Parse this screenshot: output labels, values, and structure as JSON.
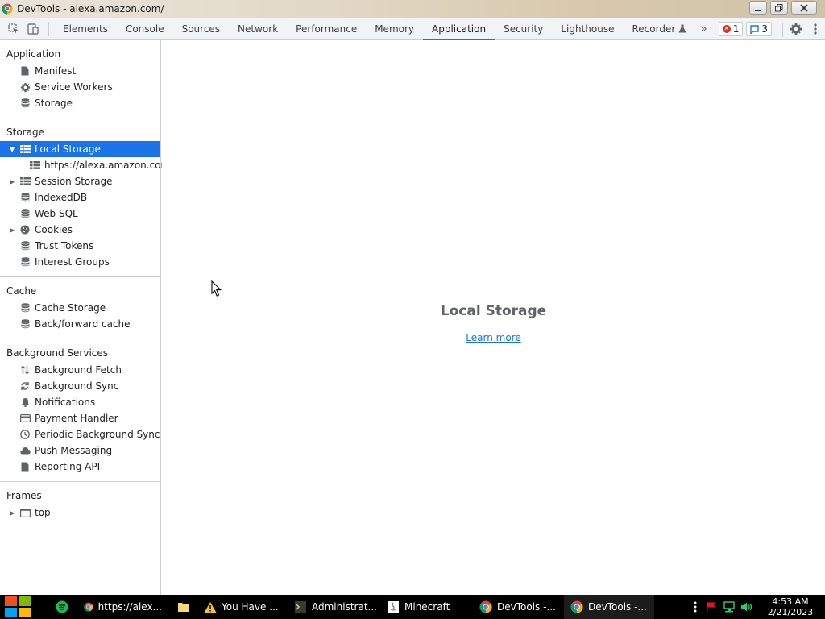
{
  "window": {
    "title": "DevTools - alexa.amazon.com/"
  },
  "toolbar": {
    "tabs": [
      {
        "label": "Elements"
      },
      {
        "label": "Console"
      },
      {
        "label": "Sources"
      },
      {
        "label": "Network"
      },
      {
        "label": "Performance"
      },
      {
        "label": "Memory"
      },
      {
        "label": "Application"
      },
      {
        "label": "Security"
      },
      {
        "label": "Lighthouse"
      },
      {
        "label": "Recorder"
      }
    ],
    "active_tab": "Application",
    "more": "»",
    "error_count": "1",
    "message_count": "3"
  },
  "sidebar": {
    "application": {
      "title": "Application",
      "items": [
        {
          "label": "Manifest",
          "icon": "file-icon"
        },
        {
          "label": "Service Workers",
          "icon": "gear-icon"
        },
        {
          "label": "Storage",
          "icon": "database-icon"
        }
      ]
    },
    "storage": {
      "title": "Storage",
      "items": [
        {
          "label": "Local Storage",
          "icon": "grid-icon"
        },
        {
          "label": "https://alexa.amazon.com",
          "icon": "grid-icon"
        },
        {
          "label": "Session Storage",
          "icon": "grid-icon"
        },
        {
          "label": "IndexedDB",
          "icon": "database-icon"
        },
        {
          "label": "Web SQL",
          "icon": "database-icon"
        },
        {
          "label": "Cookies",
          "icon": "cookie-icon"
        },
        {
          "label": "Trust Tokens",
          "icon": "database-icon"
        },
        {
          "label": "Interest Groups",
          "icon": "database-icon"
        }
      ]
    },
    "cache": {
      "title": "Cache",
      "items": [
        {
          "label": "Cache Storage",
          "icon": "database-icon"
        },
        {
          "label": "Back/forward cache",
          "icon": "database-icon"
        }
      ]
    },
    "background": {
      "title": "Background Services",
      "items": [
        {
          "label": "Background Fetch",
          "icon": "arrows-updown-icon"
        },
        {
          "label": "Background Sync",
          "icon": "sync-icon"
        },
        {
          "label": "Notifications",
          "icon": "bell-icon"
        },
        {
          "label": "Payment Handler",
          "icon": "card-icon"
        },
        {
          "label": "Periodic Background Sync",
          "icon": "clock-icon"
        },
        {
          "label": "Push Messaging",
          "icon": "cloud-icon"
        },
        {
          "label": "Reporting API",
          "icon": "file-icon"
        }
      ]
    },
    "frames": {
      "title": "Frames",
      "items": [
        {
          "label": "top",
          "icon": "frame-icon"
        }
      ]
    }
  },
  "main": {
    "title": "Local Storage",
    "link": "Learn more"
  },
  "taskbar": {
    "tasks": [
      {
        "label": "https://alex..."
      },
      {
        "label": "You Have ..."
      },
      {
        "label": "Administrat..."
      },
      {
        "label": "Minecraft"
      },
      {
        "label": "DevTools -..."
      },
      {
        "label": "DevTools -..."
      }
    ],
    "time": "4:53 AM",
    "date": "2/21/2023"
  },
  "colors": {
    "accent": "#1a73e8",
    "selected_bg": "#1a73e8",
    "taskbar": "#000000"
  }
}
